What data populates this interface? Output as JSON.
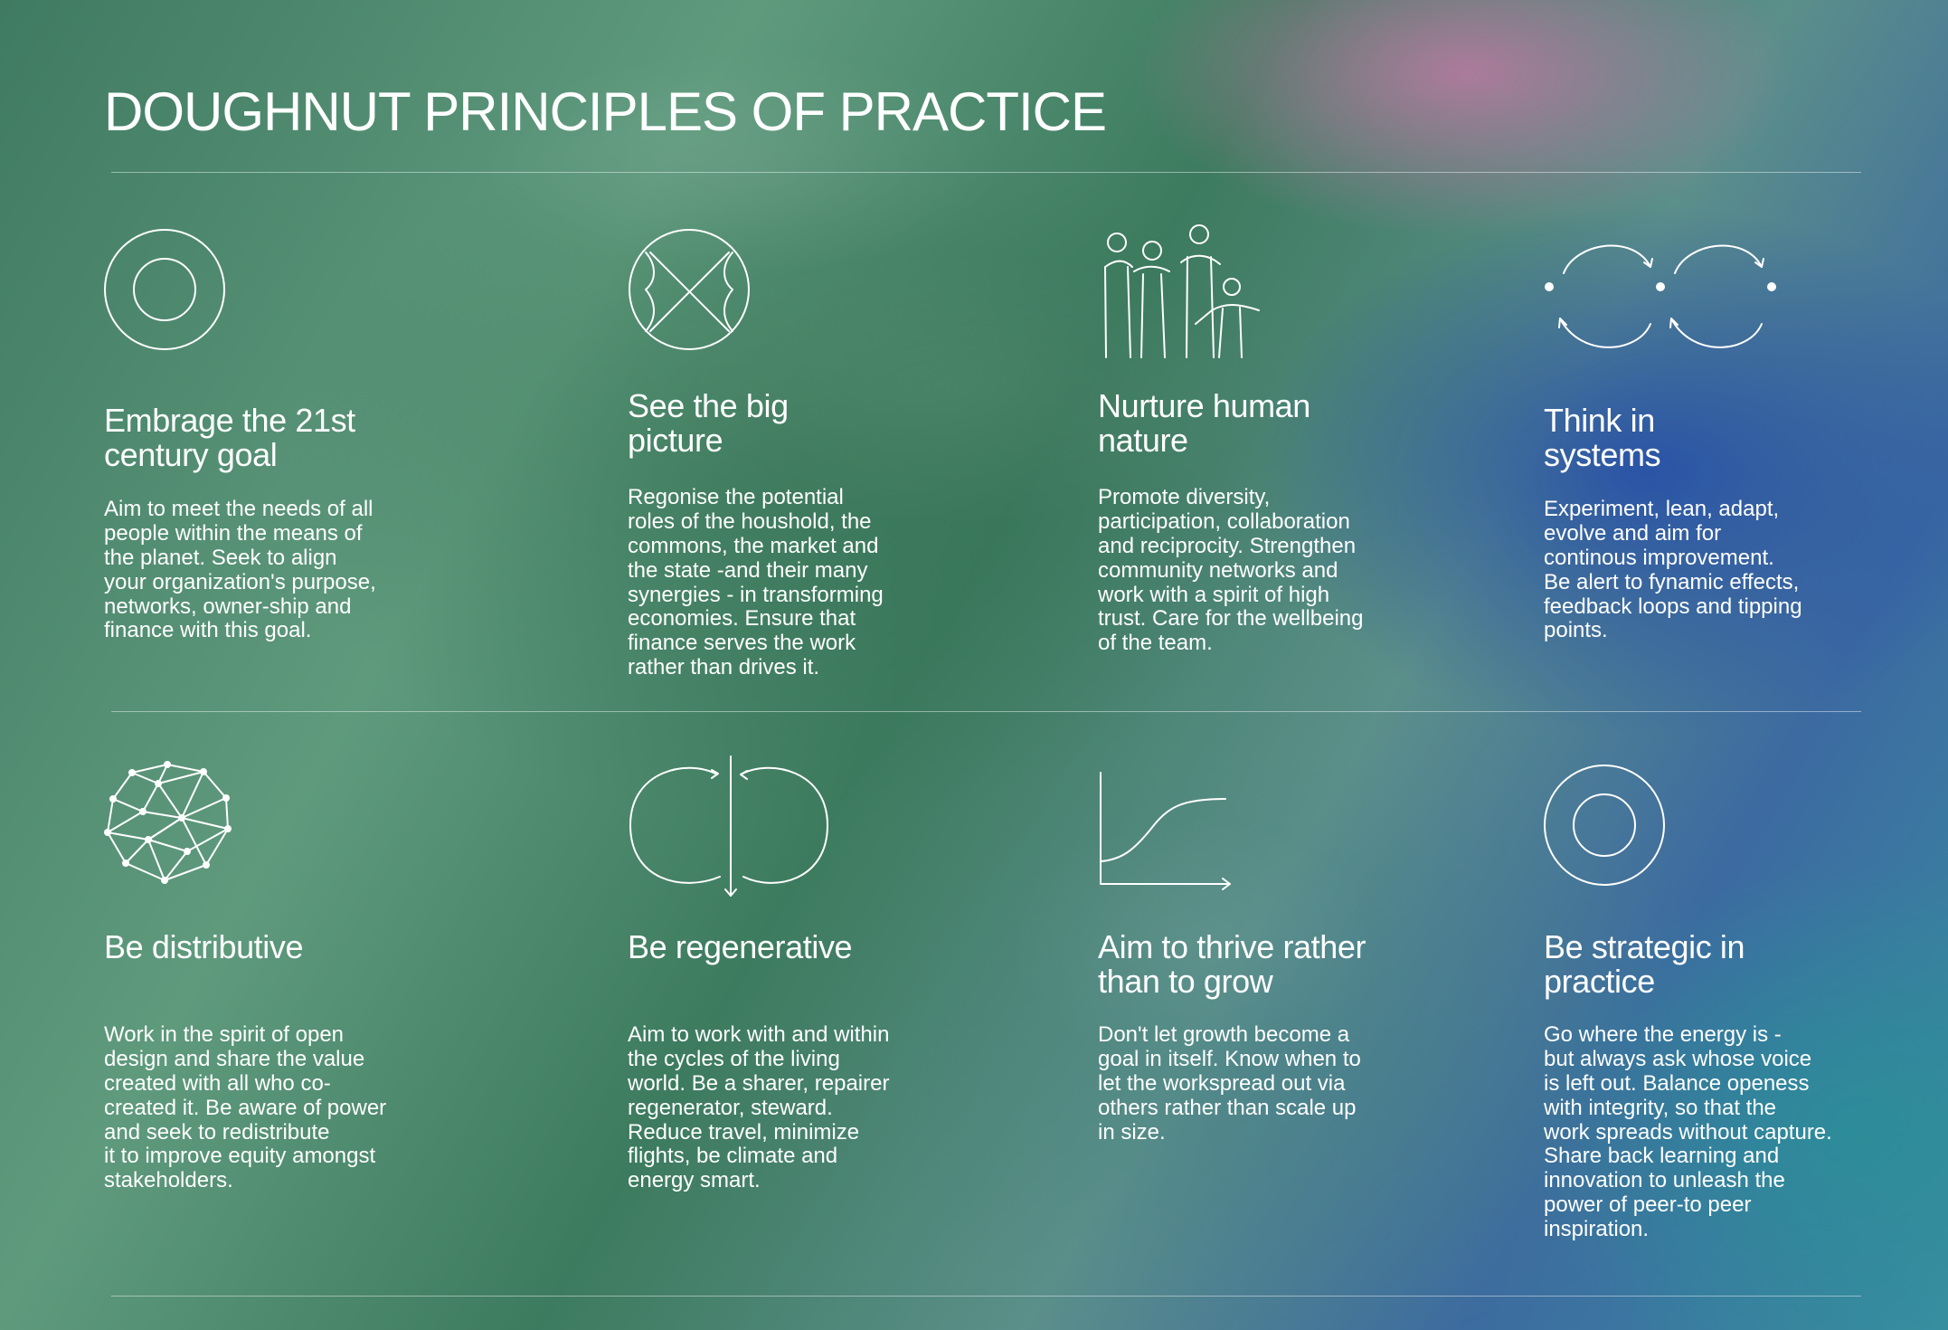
{
  "title": "DOUGHNUT PRINCIPLES OF PRACTICE",
  "principles": [
    {
      "heading": "Embrage the 21st\ncentury goal",
      "body": "Aim to meet the needs of all\npeople within the means of\nthe planet. Seek to align\nyour organization's purpose,\nnetworks, owner-ship and\nfinance with this goal.",
      "icon": "doughnut-icon"
    },
    {
      "heading": "See the big\npicture",
      "body": "Regonise the potential\nroles of the houshold, the\ncommons, the market and\nthe state -and their many\nsynergies - in transforming\neconomies. Ensure that\nfinance serves the work\nrather than drives it.",
      "icon": "big-picture-icon"
    },
    {
      "heading": "Nurture human\nnature",
      "body": "Promote diversity,\nparticipation, collaboration\nand reciprocity. Strengthen\ncommunity networks and\nwork with a spirit of high\ntrust. Care for the wellbeing\nof the team.",
      "icon": "people-icon"
    },
    {
      "heading": "Think in\nsystems",
      "body": "Experiment, lean, adapt,\nevolve and aim for\ncontinous improvement.\nBe alert to fynamic effects,\nfeedback loops and tipping\npoints.",
      "icon": "systems-loops-icon"
    },
    {
      "heading": "Be distributive",
      "body": "Work in the spirit of open\ndesign and share the value\ncreated with all who co-\ncreated it. Be aware of power\nand seek to redistribute\nit to improve equity amongst\n stakeholders.",
      "icon": "network-icon"
    },
    {
      "heading": "Be regenerative",
      "body": "Aim to work with and within\nthe cycles of the living\nworld. Be a sharer, repairer\nregenerator, steward.\nReduce travel, minimize\nflights, be climate and\nenergy smart.",
      "icon": "regenerative-cycle-icon"
    },
    {
      "heading": "Aim to thrive rather\nthan to grow",
      "body": "Don't let growth become a\ngoal in itself. Know when to\nlet the workspread out via\nothers rather than scale up\nin size.",
      "icon": "s-curve-icon"
    },
    {
      "heading": "Be strategic in\npractice",
      "body": "Go where the energy is -\nbut always ask whose voice\nis left out. Balance openess\nwith integrity, so that the\nwork spreads without capture.\nShare back learning and\ninnovation to unleash the\npower of peer-to peer\n inspiration.",
      "icon": "strategic-doughnut-icon"
    }
  ]
}
